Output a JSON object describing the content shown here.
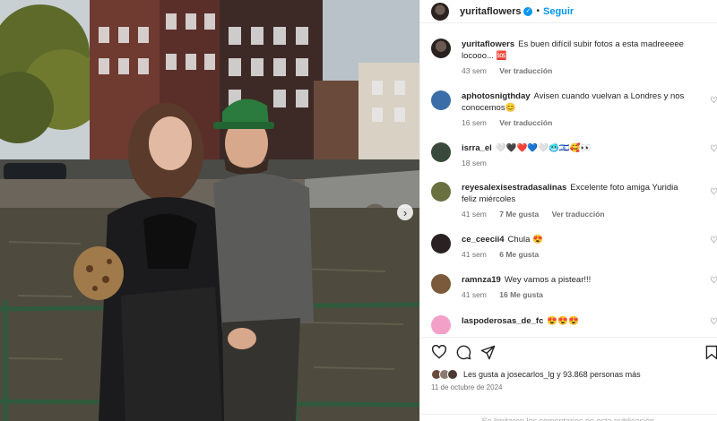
{
  "post": {
    "username": "yuritaflowers",
    "follow_label": "Seguir",
    "separator": "•"
  },
  "comments": [
    {
      "user": "yuritaflowers",
      "text": "Es buen difícil subir fotos a esta madreeeee locooo... 🆘",
      "time": "43 sem",
      "likes": "",
      "reply": "Ver traducción"
    },
    {
      "user": "aphotosnigthday",
      "text": "Avisen cuando vuelvan a Londres y nos conocemos😊",
      "time": "16 sem",
      "likes": "",
      "reply": "Ver traducción"
    },
    {
      "user": "isrra_el",
      "text": "🤍🖤❤️💙🤍🥶🇮🇱🥰👀",
      "time": "18 sem",
      "likes": "",
      "reply": ""
    },
    {
      "user": "reyesalexisestradasalinas",
      "text": "Excelente foto amiga Yuridia feliz miércoles",
      "time": "41 sem",
      "likes": "7 Me gusta",
      "reply": "Ver traducción"
    },
    {
      "user": "ce_ceecii4",
      "text": "Chula 😍",
      "time": "41 sem",
      "likes": "6 Me gusta",
      "reply": ""
    },
    {
      "user": "ramnza19",
      "text": "Wey vamos a pistear!!!",
      "time": "41 sem",
      "likes": "16 Me gusta",
      "reply": ""
    },
    {
      "user": "laspoderosas_de_fc",
      "text": "😍😍😍",
      "time": "41 sem",
      "likes": "",
      "reply": ""
    }
  ],
  "likes_text": "Les gusta a josecarlos_lg y 93.868 personas más",
  "date": "11 de octubre de 2024",
  "footer_note": "Se limitaron los comentarios en esta publicación.",
  "icons": {
    "like": "heart-icon",
    "comment": "comment-icon",
    "share": "send-icon",
    "save": "bookmark-icon",
    "next": "chevron-right-icon"
  },
  "colors": {
    "accent": "#0095f6",
    "meta": "#737373",
    "text": "#262626"
  }
}
